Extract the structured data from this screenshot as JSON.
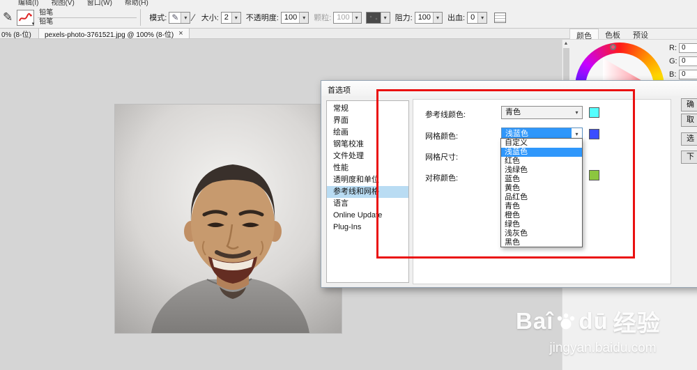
{
  "menubar": {
    "items": [
      "编辑(I)",
      "视图(V)",
      "窗口(W)",
      "帮助(H)"
    ]
  },
  "toolbar": {
    "tool_line1": "铅笔",
    "tool_line2": "铅笔",
    "mode_label": "模式:",
    "size_label": "大小:",
    "size_value": "2",
    "opacity_label": "不透明度:",
    "opacity_value": "100",
    "grain_label": "颗粒:",
    "grain_value": "100",
    "resistance_label": "阻力:",
    "resistance_value": "100",
    "bleed_label": "出血:",
    "bleed_value": "0"
  },
  "tabbar": {
    "left_partial_tab": "0% (8-位)",
    "active_tab": "pexels-photo-3761521.jpg @ 100% (8-位)",
    "close_glyph": "×"
  },
  "panel": {
    "tabs": [
      "颜色",
      "色板",
      "预设"
    ],
    "rgb": [
      {
        "label": "R:",
        "value": "0"
      },
      {
        "label": "G:",
        "value": "0"
      },
      {
        "label": "B:",
        "value": "0"
      }
    ]
  },
  "dialog": {
    "title": "首选项",
    "categories": [
      "常规",
      "界面",
      "绘画",
      "钢笔校准",
      "文件处理",
      "性能",
      "透明度和单位",
      "参考线和网格",
      "语言",
      "Online Update",
      "Plug-Ins"
    ],
    "selected_category": "参考线和网格",
    "guide_color_label": "参考线颜色:",
    "guide_color_value": "青色",
    "grid_color_label": "网格颜色:",
    "grid_color_value": "浅蓝色",
    "grid_size_label": "网格尺寸:",
    "symmetry_color_label": "对称颜色:",
    "options": [
      "自定义",
      "浅蓝色",
      "红色",
      "浅绿色",
      "蓝色",
      "黄色",
      "品红色",
      "青色",
      "橙色",
      "绿色",
      "浅灰色",
      "黑色"
    ],
    "selected_option": "浅蓝色",
    "side_buttons": [
      "确",
      "取",
      "选",
      "下"
    ]
  },
  "swatches": {
    "guide": "#55ffff",
    "grid": "#3b4eff",
    "symmetry": "#8cc63f"
  },
  "colors": {
    "annotation_red": "#ea1010",
    "option_highlight": "#2f97fb",
    "list_selection": "#b9dcf3"
  },
  "icons": {
    "pencil_tool": "✎",
    "mode_pencil": "✎",
    "dropdown_arrow": "▾",
    "scroll_up": "▲",
    "slash": "∕"
  },
  "watermark": {
    "brand_left": "Baî",
    "brand_right": "dū",
    "brand_cn": "经验",
    "url": "jingyan.baidu.com"
  }
}
